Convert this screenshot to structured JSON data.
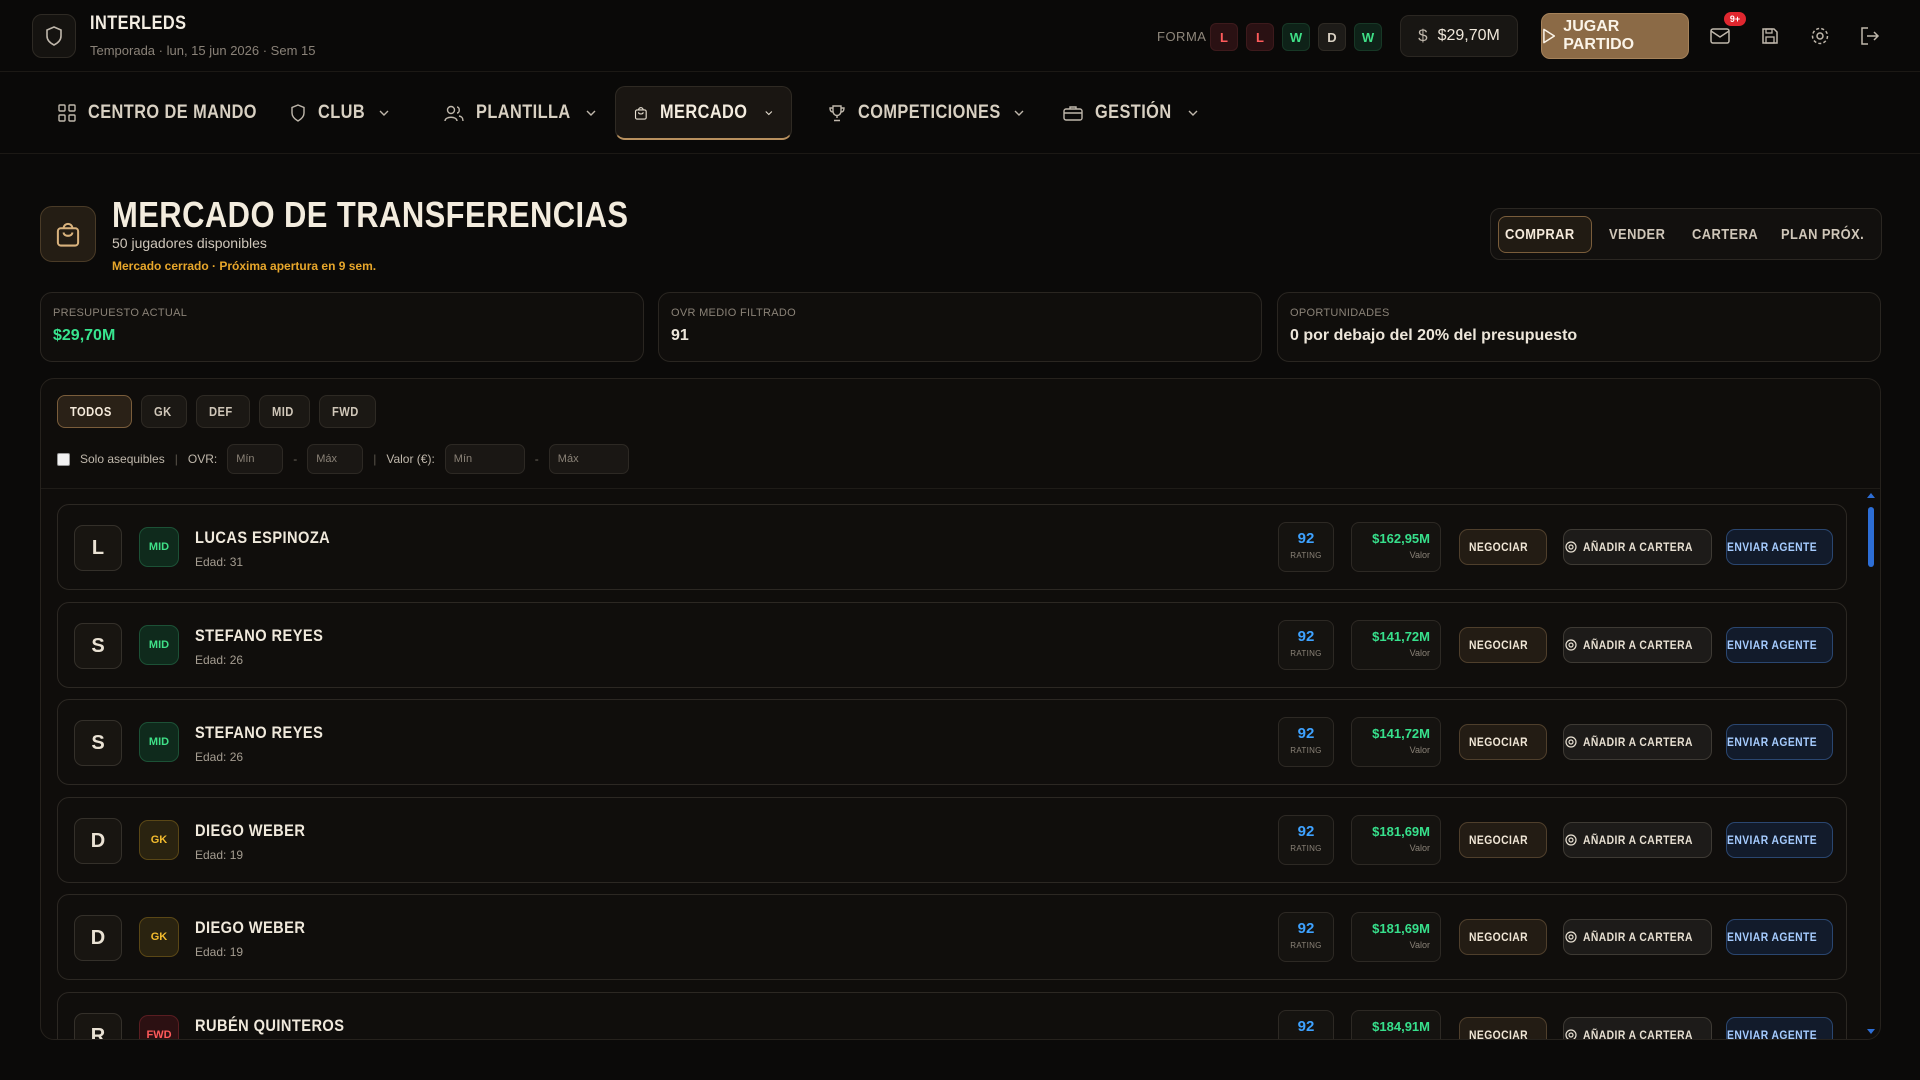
{
  "app": {
    "name": "INTERLEDS",
    "subtitle": "Temporada · lun, 15 jun 2026 · Sem 15"
  },
  "topbar": {
    "forma_label": "FORMA",
    "forma": [
      "L",
      "L",
      "W",
      "D",
      "W"
    ],
    "budget": "$29,70M",
    "play_label": "JUGAR PARTIDO",
    "notifications": "9+"
  },
  "nav": {
    "items": [
      {
        "label": "CENTRO DE MANDO",
        "icon": "grid-icon",
        "dropdown": false
      },
      {
        "label": "CLUB",
        "icon": "shield-icon",
        "dropdown": true
      },
      {
        "label": "PLANTILLA",
        "icon": "users-icon",
        "dropdown": true
      },
      {
        "label": "MERCADO",
        "icon": "shopping-bag-icon",
        "dropdown": true,
        "active": true
      },
      {
        "label": "COMPETICIONES",
        "icon": "trophy-icon",
        "dropdown": true
      },
      {
        "label": "GESTIÓN",
        "icon": "briefcase-icon",
        "dropdown": true
      }
    ]
  },
  "market": {
    "title": "MERCADO DE TRANSFERENCIAS",
    "subtitle": "50 jugadores disponibles",
    "warning": "Mercado cerrado · Próxima apertura en 9 sem.",
    "tabs": [
      "COMPRAR",
      "VENDER",
      "CARTERA",
      "PLAN PRÓX."
    ],
    "active_tab": "COMPRAR"
  },
  "stats": [
    {
      "label": "PRESUPUESTO ACTUAL",
      "value": "$29,70M"
    },
    {
      "label": "OVR MEDIO FILTRADO",
      "value": "91"
    },
    {
      "label": "OPORTUNIDADES",
      "value": "0 por debajo del 20% del presupuesto"
    }
  ],
  "filters": {
    "positions": [
      "TODOS",
      "GK",
      "DEF",
      "MID",
      "FWD"
    ],
    "active_position": "TODOS",
    "affordable_label": "Solo asequibles",
    "ovr_label": "OVR:",
    "value_label": "Valor (€):",
    "min_placeholder": "Mín",
    "max_placeholder": "Máx",
    "dash": "-",
    "sep": "|"
  },
  "row_labels": {
    "rating": "RATING",
    "value": "Valor",
    "negotiate": "NEGOCIAR",
    "add_cart": "AÑADIR A CARTERA",
    "send_agent": "ENVIAR AGENTE"
  },
  "players": [
    {
      "initial": "L",
      "pos": "MID",
      "name": "LUCAS ESPINOZA",
      "age": "Edad: 31",
      "rating": "92",
      "value": "$162,95M"
    },
    {
      "initial": "S",
      "pos": "MID",
      "name": "STEFANO REYES",
      "age": "Edad: 26",
      "rating": "92",
      "value": "$141,72M"
    },
    {
      "initial": "S",
      "pos": "MID",
      "name": "STEFANO REYES",
      "age": "Edad: 26",
      "rating": "92",
      "value": "$141,72M"
    },
    {
      "initial": "D",
      "pos": "GK",
      "name": "DIEGO WEBER",
      "age": "Edad: 19",
      "rating": "92",
      "value": "$181,69M"
    },
    {
      "initial": "D",
      "pos": "GK",
      "name": "DIEGO WEBER",
      "age": "Edad: 19",
      "rating": "92",
      "value": "$181,69M"
    },
    {
      "initial": "R",
      "pos": "FWD",
      "name": "RUBÉN QUINTEROS",
      "age": "",
      "rating": "92",
      "value": "$184,91M"
    }
  ],
  "colors": {
    "accent": "#8b6a46",
    "green": "#38e58f",
    "blue": "#3ea2ff",
    "warning": "#e8a72b",
    "loss": "#ff5b5b"
  }
}
